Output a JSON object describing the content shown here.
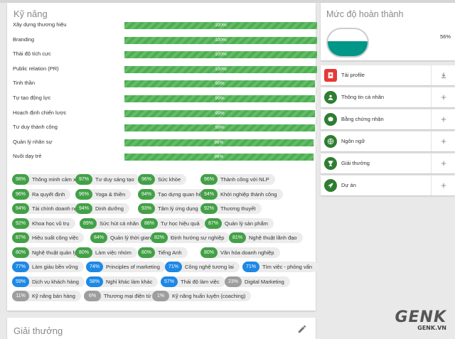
{
  "skills": {
    "title": "Kỹ năng",
    "bars": [
      {
        "label": "Xây dựng thương hiệu",
        "percent": 100,
        "text": "100%"
      },
      {
        "label": "Branding",
        "percent": 100,
        "text": "100%"
      },
      {
        "label": "Thái độ tích cực",
        "percent": 100,
        "text": "100%"
      },
      {
        "label": "Public relation (PR)",
        "percent": 100,
        "text": "100%"
      },
      {
        "label": "Tinh thần",
        "percent": 99,
        "text": "99%"
      },
      {
        "label": "Tự tạo động lực",
        "percent": 99,
        "text": "99%"
      },
      {
        "label": "Hoạch định chiến lược",
        "percent": 99,
        "text": "99%"
      },
      {
        "label": "Tư duy thành công",
        "percent": 99,
        "text": "99%"
      },
      {
        "label": "Quản lý nhân sự",
        "percent": 98,
        "text": "98%"
      },
      {
        "label": "Nuôi dạy trẻ",
        "percent": 98,
        "text": "98%"
      }
    ],
    "chip_rows": [
      [
        {
          "pct": "98%",
          "label": "Thông minh cảm xúc",
          "color": "#43a047"
        },
        {
          "pct": "97%",
          "label": "Tư duy sáng tạo",
          "color": "#43a047"
        },
        {
          "pct": "96%",
          "label": "Sức khỏe",
          "color": "#43a047"
        },
        {
          "pct": "96%",
          "label": "Thành công với NLP",
          "color": "#43a047"
        }
      ],
      [
        {
          "pct": "96%",
          "label": "Ra quyết định",
          "color": "#43a047"
        },
        {
          "pct": "96%",
          "label": "Yoga & thiền",
          "color": "#43a047"
        },
        {
          "pct": "94%",
          "label": "Tạo dựng quan hệ",
          "color": "#43a047"
        },
        {
          "pct": "94%",
          "label": "Khởi nghiệp thành công",
          "color": "#43a047"
        }
      ],
      [
        {
          "pct": "94%",
          "label": "Tài chính doanh nghiệp",
          "color": "#43a047"
        },
        {
          "pct": "94%",
          "label": "Dinh dưỡng",
          "color": "#43a047"
        },
        {
          "pct": "93%",
          "label": "Tâm lý ứng dụng",
          "color": "#43a047"
        },
        {
          "pct": "92%",
          "label": "Thương thuyết",
          "color": "#43a047"
        }
      ],
      [
        {
          "pct": "92%",
          "label": "Khoa học vũ trụ",
          "color": "#43a047"
        },
        {
          "pct": "89%",
          "label": "Sức hút cá nhân",
          "color": "#43a047"
        },
        {
          "pct": "88%",
          "label": "Tự học hiệu quả",
          "color": "#43a047"
        },
        {
          "pct": "87%",
          "label": "Quản lý sản phẩm",
          "color": "#43a047"
        }
      ],
      [
        {
          "pct": "87%",
          "label": "Hiệu suất công việc",
          "color": "#43a047"
        },
        {
          "pct": "84%",
          "label": "Quản lý thời gian",
          "color": "#43a047"
        },
        {
          "pct": "82%",
          "label": "Định hướng sự nghiệp",
          "color": "#43a047"
        },
        {
          "pct": "81%",
          "label": "Nghệ thuật lãnh đạo",
          "color": "#43a047"
        }
      ],
      [
        {
          "pct": "80%",
          "label": "Nghệ thuật quản lý",
          "color": "#43a047"
        },
        {
          "pct": "80%",
          "label": "Làm việc nhóm",
          "color": "#43a047"
        },
        {
          "pct": "80%",
          "label": "Tiếng Anh",
          "color": "#43a047"
        },
        {
          "pct": "80%",
          "label": "Văn hóa doanh nghiệp",
          "color": "#43a047"
        }
      ],
      [
        {
          "pct": "77%",
          "label": "Làm giàu bền vững",
          "color": "#1e88e5"
        },
        {
          "pct": "74%",
          "label": "Principles of marketing",
          "color": "#1e88e5"
        },
        {
          "pct": "71%",
          "label": "Công nghệ tương lai",
          "color": "#1e88e5"
        },
        {
          "pct": "71%",
          "label": "Tìm việc - phỏng vấn",
          "color": "#1e88e5"
        }
      ],
      [
        {
          "pct": "59%",
          "label": "Dịch vụ khách hàng",
          "color": "#1e88e5"
        },
        {
          "pct": "58%",
          "label": "Nghỉ khác làm khác",
          "color": "#1e88e5"
        },
        {
          "pct": "57%",
          "label": "Thái độ làm việc",
          "color": "#1e88e5"
        },
        {
          "pct": "23%",
          "label": "Digital Marketing",
          "color": "#9e9e9e"
        }
      ],
      [
        {
          "pct": "11%",
          "label": "Kỹ năng bán hàng",
          "color": "#9e9e9e"
        },
        {
          "pct": "6%",
          "label": "Thương mại điện tử",
          "color": "#9e9e9e"
        },
        {
          "pct": "1%",
          "label": "Kỹ năng huấn luyện (coaching)",
          "color": "#9e9e9e"
        }
      ]
    ]
  },
  "awards": {
    "title": "Giải thưởng",
    "edit_icon": "pencil-icon"
  },
  "completion": {
    "title": "Mức độ hoàn thành",
    "percent_text": "56%",
    "level": 0.56,
    "color": "#009688"
  },
  "side_menu": [
    {
      "label": "Tải profile",
      "icon": "pdf-icon",
      "color": "#e53935",
      "action": "download-icon"
    },
    {
      "label": "Thông tin cá nhân",
      "icon": "person-icon",
      "color": "#2e7d32",
      "action": "plus-icon"
    },
    {
      "label": "Bằng chứng nhận",
      "icon": "badge-icon",
      "color": "#2e7d32",
      "action": "plus-icon"
    },
    {
      "label": "Ngôn ngữ",
      "icon": "globe-icon",
      "color": "#2e7d32",
      "action": "plus-icon"
    },
    {
      "label": "Giải thưởng",
      "icon": "trophy-icon",
      "color": "#2e7d32",
      "action": "plus-icon"
    },
    {
      "label": "Dự án",
      "icon": "rocket-icon",
      "color": "#2e7d32",
      "action": "plus-icon"
    }
  ],
  "watermark": {
    "brand": "GENK",
    "domain": "GENK.VN"
  }
}
